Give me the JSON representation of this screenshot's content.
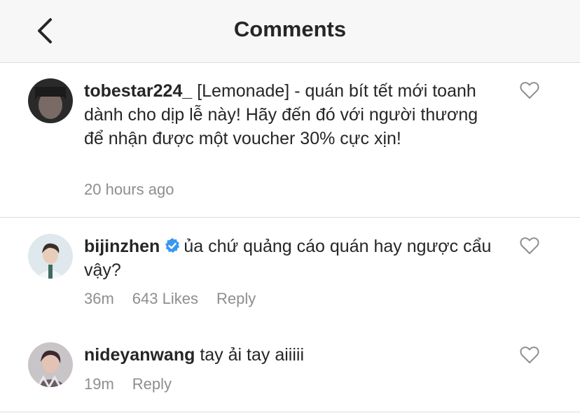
{
  "header": {
    "title": "Comments",
    "back_icon": "chevron-left-icon"
  },
  "comments": [
    {
      "username": "tobestar224_",
      "verified": false,
      "text": "[Lemonade] - quán bít tết mới toanh dành cho dịp lễ này! Hãy đến đó với người thương để nhận được một voucher 30% cực xịn!",
      "time": "20 hours ago"
    },
    {
      "username": "bijinzhen",
      "verified": true,
      "text": "ủa chứ quảng cáo quán hay ngược cẩu vậy?",
      "time": "36m",
      "likes": "643 Likes",
      "reply": "Reply"
    },
    {
      "username": "nideyanwang",
      "verified": false,
      "text": "tay ải tay aiiiii",
      "time": "19m",
      "reply": "Reply"
    }
  ],
  "colors": {
    "meta": "#8e8e8e",
    "verified": "#3897f0",
    "divider": "#dbdbdb"
  }
}
